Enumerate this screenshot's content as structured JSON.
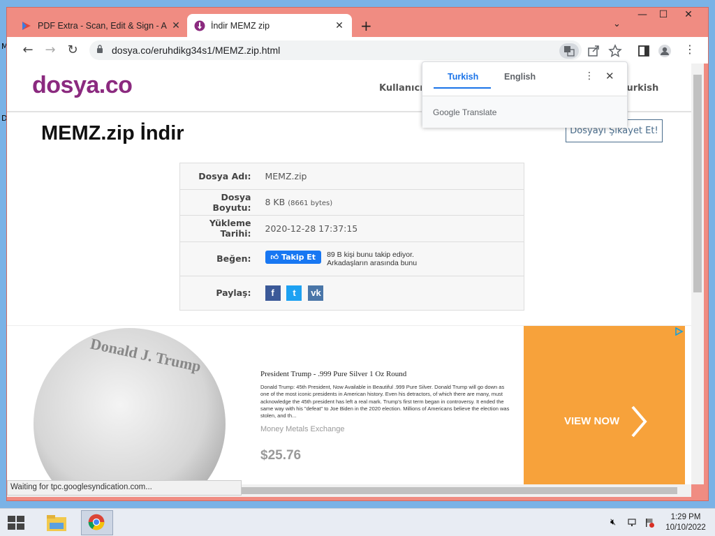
{
  "desktop": {
    "edge_letters": [
      "M",
      "D"
    ]
  },
  "browser": {
    "tabs": [
      {
        "title": "PDF Extra - Scan, Edit & Sign - A",
        "active": false
      },
      {
        "title": "İndir MEMZ zip",
        "active": true
      }
    ],
    "new_tab": "+",
    "tab_search": "⌄",
    "window_controls": {
      "minimize": "—",
      "maximize": "☐",
      "close": "✕"
    },
    "url": "dosya.co/eruhdikg34s1/MEMZ.zip.html",
    "status_text": "Waiting for tpc.googlesyndication.com..."
  },
  "site": {
    "logo": "dosya.co",
    "nav_user": "Kullanıcı",
    "nav_lang": "Turkish",
    "page_title": "MEMZ.zip İndir",
    "report_button": "Dosyayı Şikayet Et!",
    "file_info": {
      "name_label": "Dosya Adı:",
      "name_value": "MEMZ.zip",
      "size_label": "Dosya Boyutu:",
      "size_value": "8 KB",
      "size_bytes": "(8661 bytes)",
      "date_label": "Yükleme Tarihi:",
      "date_value": "2020-12-28 17:37:15",
      "like_label": "Beğen:",
      "follow_button": "Takip Et",
      "follow_text_line1": "89 B kişi bunu takip ediyor.",
      "follow_text_line2": "Arkadaşların arasında bunu",
      "share_label": "Paylaş:",
      "share_icons": [
        "facebook-icon",
        "twitter-icon",
        "vk-icon"
      ]
    }
  },
  "ad": {
    "coin_text": "Donald J. Trump",
    "title": "President Trump - .999 Pure Silver 1 Oz Round",
    "body": "Donald Trump: 45th President, Now Available in Beautiful .999 Pure Silver. Donald Trump will go down as one of the most iconic presidents in American history. Even his detractors, of which there are many, must acknowledge the 45th president has left a real mark. Trump's first term began in controversy. It ended the same way with his \"defeat\" to Joe Biden in the 2020 election. Millions of Americans believe the election was stolen, and th...",
    "brand": "Money Metals Exchange",
    "price": "$25.76",
    "cta": "VIEW NOW",
    "cta_color": "#f7a23b"
  },
  "translate_popup": {
    "tab_source": "Turkish",
    "tab_target": "English",
    "brand": "Google Translate"
  },
  "taskbar": {
    "apps": [
      "file-explorer-icon",
      "chrome-icon"
    ],
    "time": "1:29 PM",
    "date": "10/10/2022"
  },
  "colors": {
    "window_frame": "#f08c82",
    "brand_purple": "#8b2a7f",
    "facebook_blue": "#1877f2",
    "translate_blue": "#1a73e8"
  }
}
